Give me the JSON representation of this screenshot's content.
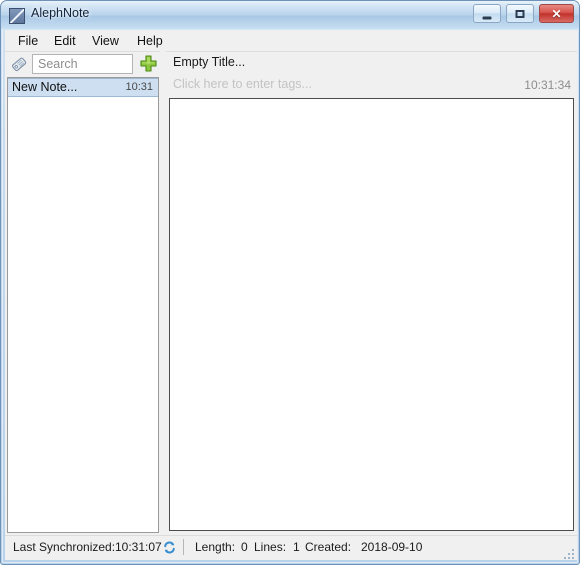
{
  "window": {
    "title": "AlephNote",
    "app_icon": "aleph-note-icon",
    "controls": {
      "minimize": {
        "name": "minimize-icon",
        "glyph": ""
      },
      "maximize": {
        "name": "maximize-icon",
        "glyph": ""
      },
      "close": {
        "name": "close-icon",
        "glyph": "✕"
      }
    },
    "accent_title_bar": "#b9d3ec",
    "close_button_color": "#c2322c"
  },
  "menu": {
    "items": [
      {
        "label": "File"
      },
      {
        "label": "Edit"
      },
      {
        "label": "View"
      },
      {
        "label": "Help"
      }
    ]
  },
  "sidebar": {
    "tag_icon": "tag-icon",
    "search": {
      "placeholder": "Search",
      "value": ""
    },
    "add_button": {
      "icon": "plus-icon",
      "color": "#7ec13d"
    },
    "notes": [
      {
        "title": "New Note...",
        "time": "10:31",
        "selected": true
      }
    ]
  },
  "note": {
    "title": "Empty Title...",
    "tags_placeholder": "Click here to enter tags...",
    "time": "10:31:34",
    "body": ""
  },
  "status": {
    "sync_label": "Last Synchronized:",
    "sync_time": "10:31:07",
    "sync_icon": "sync-icon",
    "length_label": "Length:",
    "length_value": "0",
    "lines_label": "Lines:",
    "lines_value": "1",
    "created_label": "Created:",
    "created_value": "2018-09-10"
  }
}
